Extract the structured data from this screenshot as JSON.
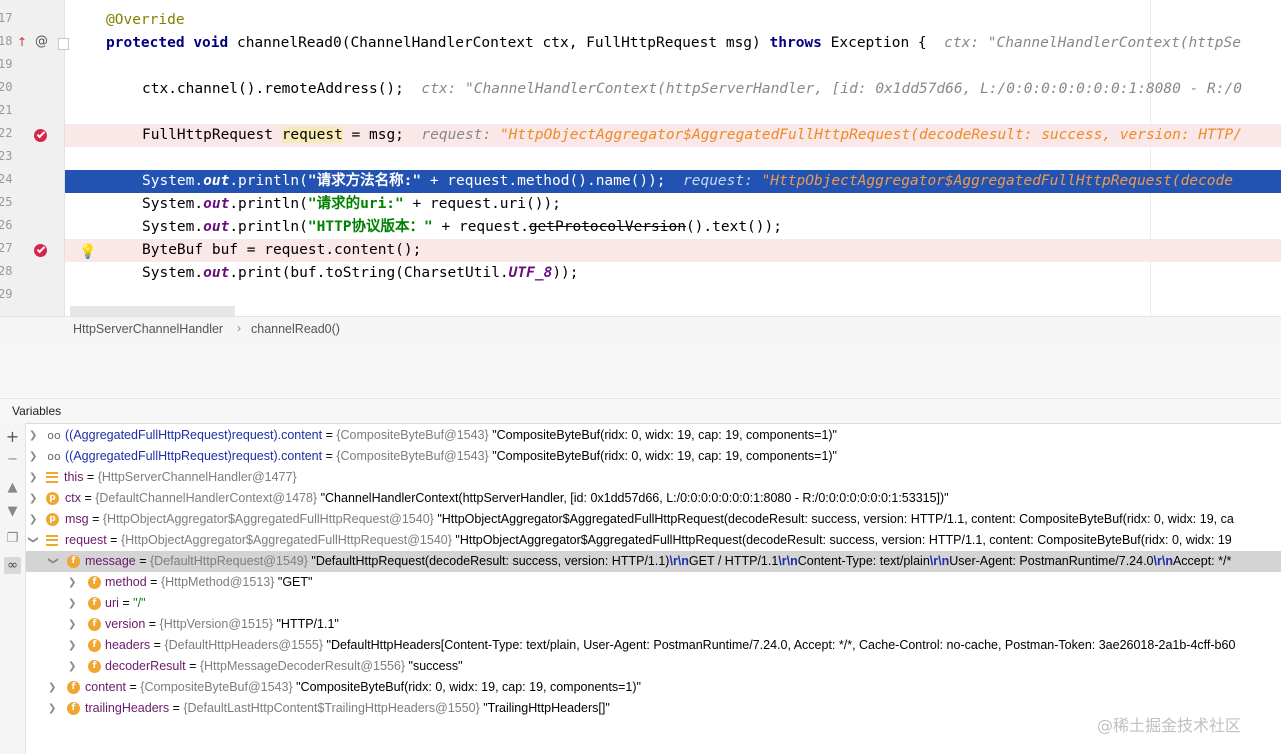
{
  "editor": {
    "lines": [
      {
        "num": "17",
        "code": [
          "@Override"
        ]
      },
      {
        "num": "18",
        "code": [
          "protected",
          "void",
          "channelRead0(ChannelHandlerContext ctx, FullHttpRequest msg)",
          "throws",
          "Exception {"
        ],
        "inline": "ctx: \"ChannelHandlerContext(httpSe"
      },
      {
        "num": "19"
      },
      {
        "num": "20",
        "code": [
          "ctx.channel().remoteAddress();"
        ],
        "inline": "ctx: \"ChannelHandlerContext(httpServerHandler, [id: 0x1dd57d66, L:/0:0:0:0:0:0:0:1:8080 - R:/0"
      },
      {
        "num": "21"
      },
      {
        "num": "22",
        "code": [
          "FullHttpRequest ",
          "request",
          " = msg;"
        ],
        "inline_label": "request: ",
        "inline_value": "\"HttpObjectAggregator$AggregatedFullHttpRequest(decodeResult: success, version: HTTP/"
      },
      {
        "num": "23"
      },
      {
        "num": "24",
        "code": [
          "System.",
          "out",
          ".println(",
          "\"请求方法名称:\"",
          " + request.method().name());"
        ],
        "inline_label": "request: ",
        "inline_value": "\"HttpObjectAggregator$AggregatedFullHttpRequest(decode"
      },
      {
        "num": "25",
        "code": [
          "System.",
          "out",
          ".println(",
          "\"请求的uri:\"",
          " + request.uri());"
        ]
      },
      {
        "num": "26",
        "code": [
          "System.",
          "out",
          ".println(",
          "\"HTTP协议版本：\"",
          " + request.",
          "getProtocolVersion",
          "().text());"
        ]
      },
      {
        "num": "27",
        "code": [
          "ByteBuf buf = request.content();"
        ]
      },
      {
        "num": "28",
        "code": [
          "System.",
          "out",
          ".print(buf.toString(CharsetUtil.",
          "UTF_8",
          "));"
        ]
      },
      {
        "num": "29"
      }
    ]
  },
  "breadcrumb": {
    "items": [
      "HttpServerChannelHandler",
      "channelRead0()"
    ]
  },
  "variables_panel": {
    "title": "Variables",
    "rows": [
      {
        "name": "((AggregatedFullHttpRequest)request).content",
        "eq": " = ",
        "type": "{CompositeByteBuf@1543}",
        "value": " \"CompositeByteBuf(ridx: 0, widx: 19, cap: 19, components=1)\""
      },
      {
        "name": "((AggregatedFullHttpRequest)request).content",
        "eq": " = ",
        "type": "{CompositeByteBuf@1543}",
        "value": " \"CompositeByteBuf(ridx: 0, widx: 19, cap: 19, components=1)\""
      },
      {
        "name": "this",
        "eq": " = ",
        "type": "{HttpServerChannelHandler@1477}",
        "value": ""
      },
      {
        "name": "ctx",
        "eq": " = ",
        "type": "{DefaultChannelHandlerContext@1478}",
        "value": " \"ChannelHandlerContext(httpServerHandler, [id: 0x1dd57d66, L:/0:0:0:0:0:0:0:1:8080 - R:/0:0:0:0:0:0:0:1:53315])\""
      },
      {
        "name": "msg",
        "eq": " = ",
        "type": "{HttpObjectAggregator$AggregatedFullHttpRequest@1540}",
        "value": " \"HttpObjectAggregator$AggregatedFullHttpRequest(decodeResult: success, version: HTTP/1.1, content: CompositeByteBuf(ridx: 0, widx: 19, ca"
      },
      {
        "name": "request",
        "eq": " = ",
        "type": "{HttpObjectAggregator$AggregatedFullHttpRequest@1540}",
        "value": " \"HttpObjectAggregator$AggregatedFullHttpRequest(decodeResult: success, version: HTTP/1.1, content: CompositeByteBuf(ridx: 0, widx: 19"
      },
      {
        "name": "message",
        "eq": " = ",
        "type": "{DefaultHttpRequest@1549}",
        "value_parts": [
          " \"DefaultHttpRequest(decodeResult: success, version: HTTP/1.1)",
          "\\r\\n",
          "GET / HTTP/1.1",
          "\\r\\n",
          "Content-Type: text/plain",
          "\\r\\n",
          "User-Agent: PostmanRuntime/7.24.0",
          "\\r\\n",
          "Accept: */*"
        ]
      },
      {
        "name": "method",
        "eq": " = ",
        "type": "{HttpMethod@1513}",
        "value": " \"GET\""
      },
      {
        "name": "uri",
        "eq": " = ",
        "type": "",
        "value": "\"/\""
      },
      {
        "name": "version",
        "eq": " = ",
        "type": "{HttpVersion@1515}",
        "value": " \"HTTP/1.1\""
      },
      {
        "name": "headers",
        "eq": " = ",
        "type": "{DefaultHttpHeaders@1555}",
        "value": " \"DefaultHttpHeaders[Content-Type: text/plain, User-Agent: PostmanRuntime/7.24.0, Accept: */*, Cache-Control: no-cache, Postman-Token: 3ae26018-2a1b-4cff-b60"
      },
      {
        "name": "decoderResult",
        "eq": " = ",
        "type": "{HttpMessageDecoderResult@1556}",
        "value": " \"success\""
      },
      {
        "name": "content",
        "eq": " = ",
        "type": "{CompositeByteBuf@1543}",
        "value": " \"CompositeByteBuf(ridx: 0, widx: 19, cap: 19, components=1)\""
      },
      {
        "name": "trailingHeaders",
        "eq": " = ",
        "type": "{DefaultLastHttpContent$TrailingHttpHeaders@1550}",
        "value": " \"TrailingHttpHeaders[]\""
      }
    ]
  },
  "watermark": "@稀土掘金技术社区",
  "colors": {
    "execution_line": "#2253b3",
    "breakpoint_line": "#fae7e7",
    "breakpoint": "#d7264c",
    "keyword": "#000080",
    "string": "#008000",
    "field": "#660e7a",
    "inline_value": "#ee8a26",
    "field_icon": "#f0a732"
  }
}
